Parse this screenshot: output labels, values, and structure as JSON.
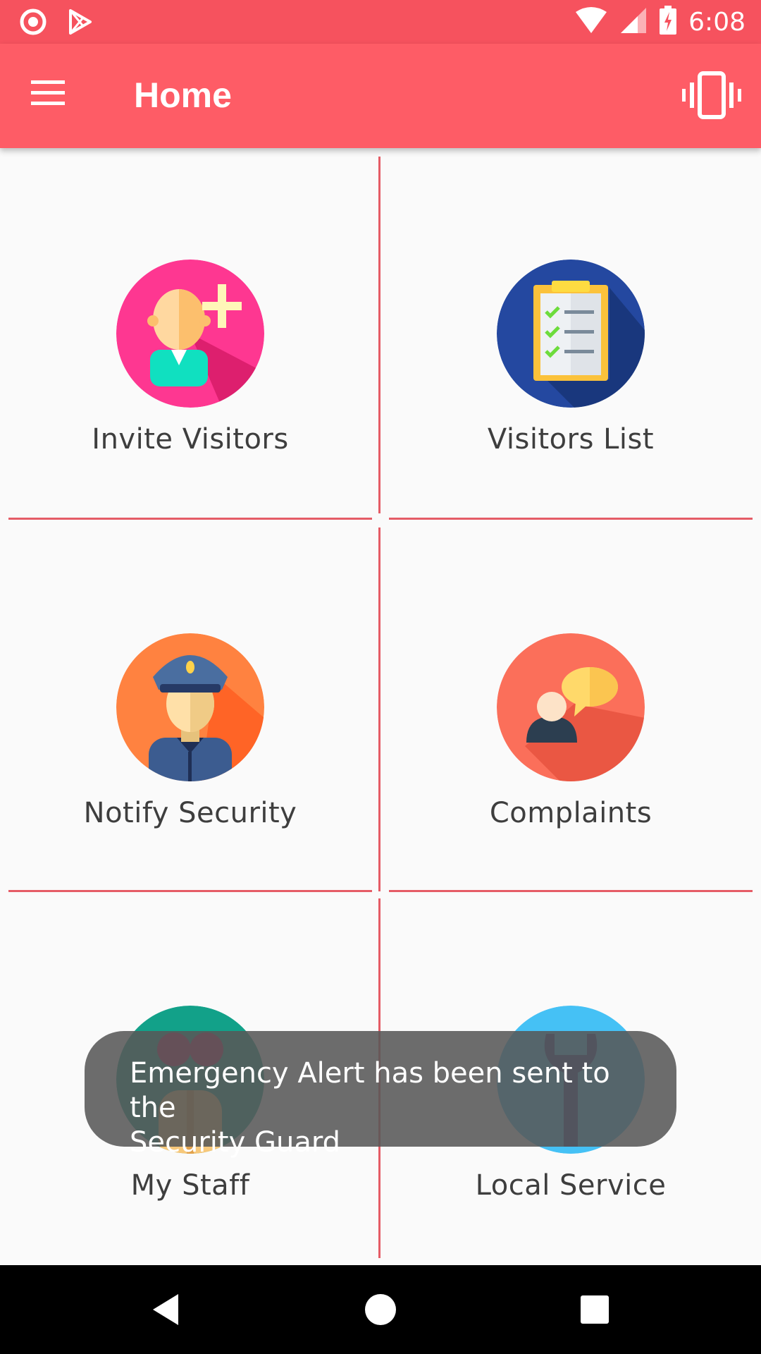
{
  "status_bar": {
    "time": "6:08",
    "left_icons": [
      "record-icon",
      "play-store-icon"
    ],
    "right_icons": [
      "wifi-icon",
      "signal-icon",
      "battery-charging-icon"
    ]
  },
  "app_bar": {
    "title": "Home",
    "menu_icon": "hamburger-menu-icon",
    "action_icon": "vibrate-icon",
    "color": "#fe5c66"
  },
  "tiles": [
    {
      "label": "Invite Visitors",
      "icon": "invite-visitor-icon",
      "color": "#ff3b8b"
    },
    {
      "label": "Visitors List",
      "icon": "clipboard-checklist-icon",
      "color": "#23489c"
    },
    {
      "label": "Notify Security",
      "icon": "security-guard-icon",
      "color": "#ff7b3d"
    },
    {
      "label": "Complaints",
      "icon": "complaint-chat-icon",
      "color": "#f96f58"
    },
    {
      "label": "My Staff",
      "icon": "staff-icon",
      "color": "#12a189"
    },
    {
      "label": "Local Service",
      "icon": "wrench-icon",
      "color": "#45c1f5"
    }
  ],
  "toast": {
    "line1": "Emergency Alert has been sent to the",
    "line2": "Security Guard"
  },
  "nav_bar": {
    "buttons": [
      "back-icon",
      "home-icon",
      "recents-icon"
    ]
  }
}
